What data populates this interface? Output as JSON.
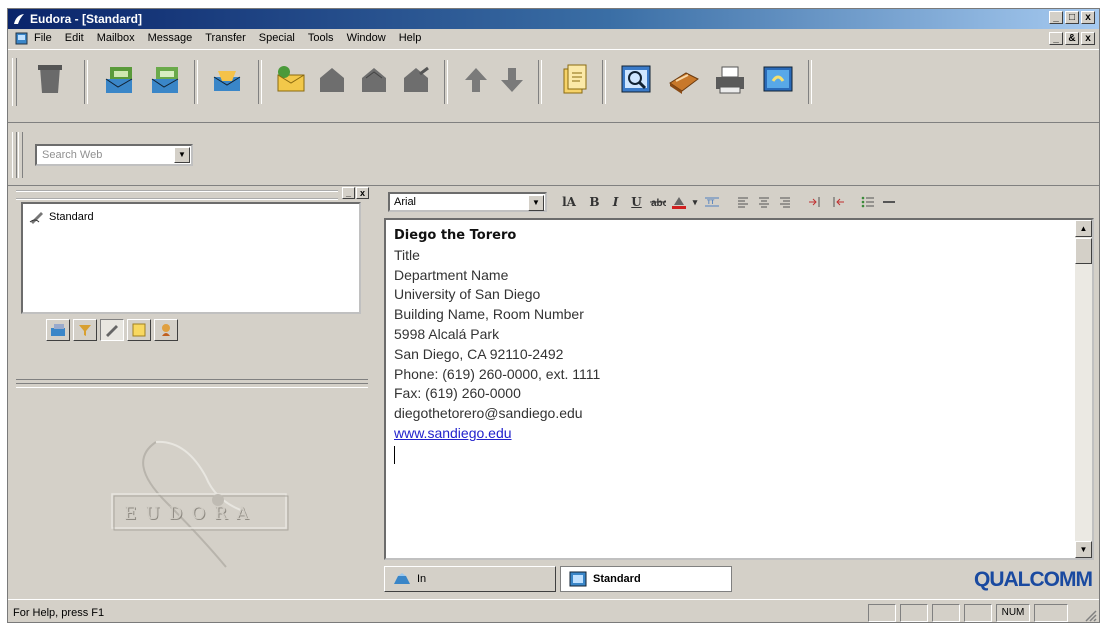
{
  "window": {
    "title": "Eudora - [Standard]",
    "minimize": "_",
    "restore": "□",
    "close": "x",
    "child_restore": "&"
  },
  "menu": [
    "File",
    "Edit",
    "Mailbox",
    "Message",
    "Transfer",
    "Special",
    "Tools",
    "Window",
    "Help"
  ],
  "toolbar_icons": [
    "trash-icon",
    "check-mail-icon",
    "send-queued-icon",
    "inbox-icon",
    "new-message-icon",
    "reply-icon",
    "reply-all-icon",
    "forward-icon",
    "previous-message-icon",
    "next-message-icon",
    "attach-file-icon",
    "find-icon",
    "address-book-icon",
    "print-icon",
    "help-icon"
  ],
  "search": {
    "placeholder": "Search Web"
  },
  "left_pane": {
    "tree_items": [
      "Standard"
    ],
    "tabs": [
      "mailboxes-tab",
      "filters-tab",
      "signatures-tab",
      "stationery-tab",
      "personalities-tab"
    ],
    "logo_text": "EUDORA"
  },
  "editor": {
    "font": "Arial",
    "signature": {
      "name": "Diego the Torero",
      "lines": [
        "Title",
        "Department Name",
        "University of San Diego",
        "Building Name, Room Number",
        "5998 Alcalá Park",
        "San Diego, CA 92110-2492",
        "Phone: (619) 260-0000, ext. 1111",
        "Fax: (619) 260-0000",
        "diegothetorero@sandiego.edu"
      ],
      "link": "www.sandiego.edu"
    },
    "doc_tabs": [
      "In",
      "Standard"
    ],
    "brand": "QUALCOMM"
  },
  "status": {
    "help_text": "For Help, press F1",
    "num": "NUM"
  },
  "colors": {
    "title_start": "#0a246a",
    "title_end": "#a6caf0",
    "face": "#d4d0c8",
    "link": "#2222cc"
  }
}
